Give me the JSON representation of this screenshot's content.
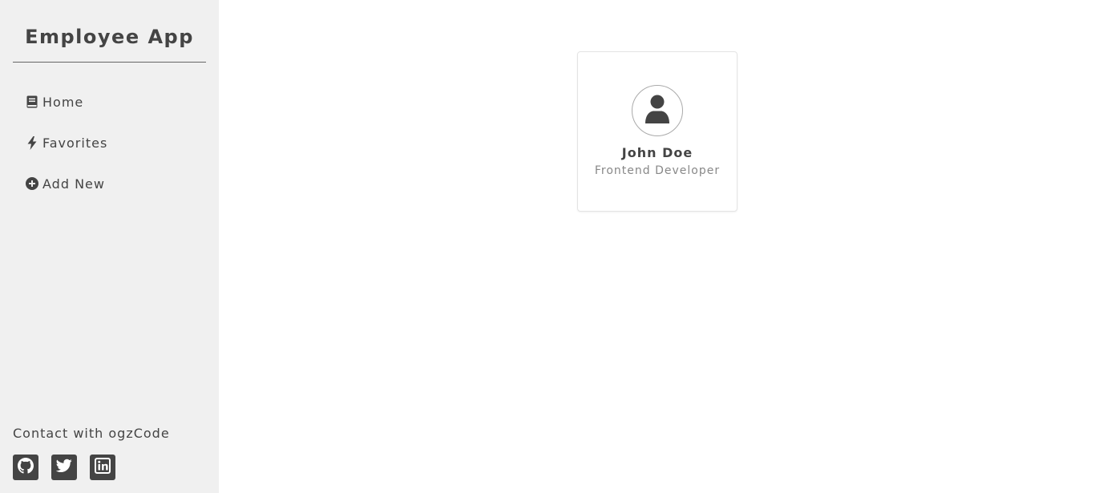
{
  "sidebar": {
    "title": "Employee App",
    "nav": [
      {
        "label": "Home",
        "icon": "book-icon"
      },
      {
        "label": "Favorites",
        "icon": "bolt-icon"
      },
      {
        "label": "Add New",
        "icon": "plus-circle-icon"
      }
    ],
    "contact_text": "Contact with ogzCode",
    "socials": [
      {
        "icon": "github-icon"
      },
      {
        "icon": "twitter-icon"
      },
      {
        "icon": "linkedin-icon"
      }
    ]
  },
  "main": {
    "employees": [
      {
        "name": "John Doe",
        "role": "Frontend Developer",
        "avatar_icon": "user-icon"
      }
    ]
  },
  "colors": {
    "sidebar_bg": "#f0f0f0",
    "text": "#444444",
    "muted_text": "#888888",
    "card_border": "#e4e4e4"
  }
}
